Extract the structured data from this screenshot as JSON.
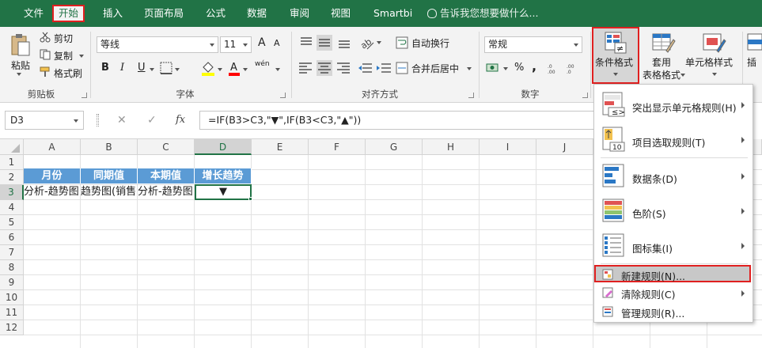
{
  "tabs": [
    "文件",
    "开始",
    "插入",
    "页面布局",
    "公式",
    "数据",
    "审阅",
    "视图",
    "Smartbi"
  ],
  "tell_me": "告诉我您想要做什么...",
  "clipboard": {
    "paste": "粘贴",
    "cut": "剪切",
    "copy": "复制",
    "format_painter": "格式刷",
    "label": "剪贴板"
  },
  "font": {
    "name": "等线",
    "size": "11",
    "bold": "B",
    "italic": "I",
    "underline": "U",
    "grow": "A",
    "shrink": "A",
    "phonetic": "wén",
    "label": "字体"
  },
  "alignment": {
    "wrap_text": "自动换行",
    "merge_center": "合并后居中",
    "label": "对齐方式"
  },
  "number": {
    "format": "常规",
    "percent": "%",
    "comma": ",",
    "label": "数字"
  },
  "styles": {
    "conditional_formatting": "条件格式",
    "table_format_1": "套用",
    "table_format_2": "表格格式",
    "cell_styles": "单元格样式",
    "insert": "插"
  },
  "formula_bar": {
    "name_box": "D3",
    "cancel": "✕",
    "enter": "✓",
    "fx": "fx",
    "formula": "=IF(B3>C3,\"▼\",IF(B3<C3,\"▲\"))"
  },
  "grid": {
    "columns": [
      "A",
      "B",
      "C",
      "D",
      "E",
      "F",
      "G",
      "H",
      "I",
      "J"
    ],
    "rows": [
      "1",
      "2",
      "3",
      "4",
      "5",
      "6",
      "7",
      "8",
      "9",
      "10",
      "11",
      "12"
    ],
    "header_cells": [
      "月份",
      "同期值",
      "本期值",
      "增长趋势"
    ],
    "row3_cells": [
      "分析-趋势图",
      "趋势图(销售",
      "分析-趋势图",
      "▼"
    ]
  },
  "menu": {
    "items": [
      {
        "label": "突出显示单元格规则(H)",
        "icon": "highlight-rules-icon",
        "submenu": true
      },
      {
        "label": "项目选取规则(T)",
        "icon": "top-bottom-rules-icon",
        "submenu": true
      },
      {
        "label": "数据条(D)",
        "icon": "data-bars-icon",
        "submenu": true
      },
      {
        "label": "色阶(S)",
        "icon": "color-scales-icon",
        "submenu": true
      },
      {
        "label": "图标集(I)",
        "icon": "icon-sets-icon",
        "submenu": true
      }
    ],
    "small_items": [
      {
        "label": "新建规则(N)...",
        "icon": "new-rule-icon",
        "submenu": false
      },
      {
        "label": "清除规则(C)",
        "icon": "clear-rules-icon",
        "submenu": true
      },
      {
        "label": "管理规则(R)...",
        "icon": "manage-rules-icon",
        "submenu": false
      }
    ],
    "icon_text_1": "≠",
    "icon_text_2": "10"
  },
  "colors": {
    "accent": "#217346",
    "header_fill": "#5b9bd5",
    "highlight": "#e02020"
  }
}
